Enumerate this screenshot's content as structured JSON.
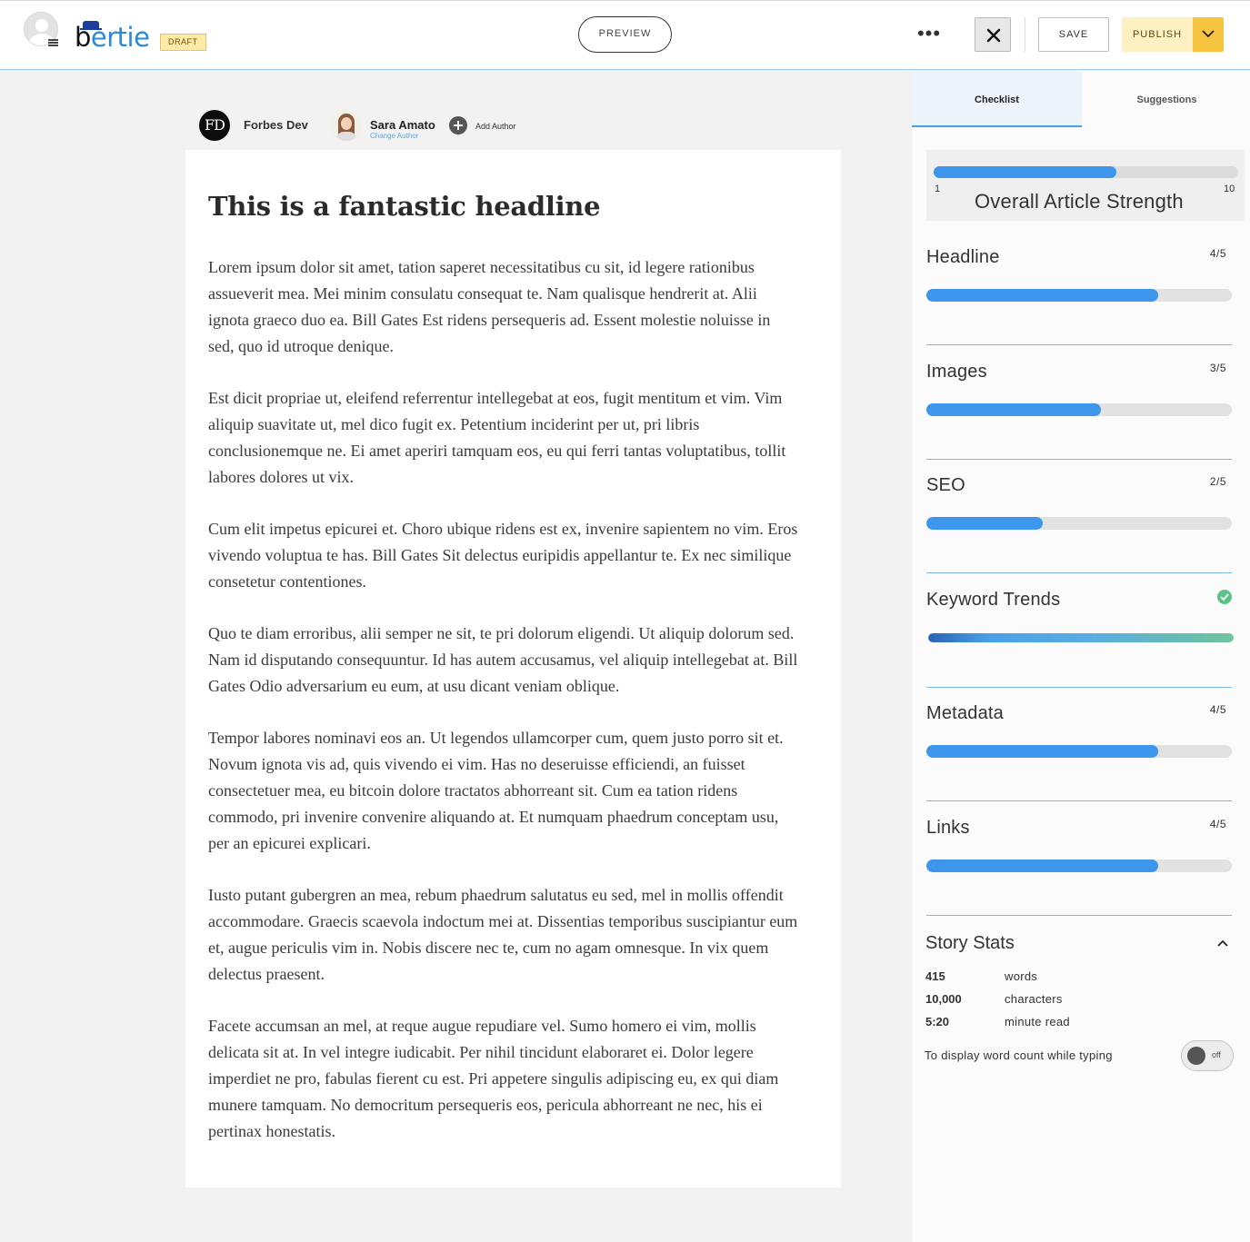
{
  "header": {
    "logo_b": "b",
    "logo_rest": "ertie",
    "draft_badge": "DRAFT",
    "preview_label": "PREVIEW",
    "more_label": "•••",
    "save_label": "SAVE",
    "publish_label": "PUBLISH"
  },
  "authors": {
    "primary_initials": "FD",
    "primary_name": "Forbes Dev",
    "secondary_name": "Sara Amato",
    "change_author": "Change Author",
    "add_author": "Add Author"
  },
  "article": {
    "headline": "This is a fantastic headline",
    "paragraphs": [
      "Lorem ipsum dolor sit amet, tation saperet necessitatibus cu sit, id legere rationibus assueverit mea. Mei minim consulatu consequat te. Nam qualisque hendrerit at. Alii ignota graeco duo ea. Bill Gates Est ridens persequeris ad. Essent molestie noluisse in sed, quo id utroque denique.",
      "Est dicit propriae ut, eleifend referrentur intellegebat at eos, fugit mentitum et vim. Vim aliquip suavitate ut, mel dico fugit ex. Petentium inciderint per ut, pri libris conclusionemque ne. Ei amet aperiri tamquam eos, eu qui ferri tantas voluptatibus, tollit labores dolores ut vix.",
      "Cum elit impetus epicurei et. Choro ubique ridens est ex, invenire sapientem no vim. Eros vivendo voluptua te has. Bill Gates Sit delectus euripidis appellantur te. Ex nec similique consetetur contentiones.",
      "Quo te diam erroribus, alii semper ne sit, te pri dolorum eligendi. Ut aliquip dolorum sed. Nam id disputando consequuntur. Id has autem accusamus, vel aliquip intellegebat at. Bill Gates Odio adversarium eu eum, at usu dicant veniam oblique.",
      "Tempor labores nominavi eos an. Ut legendos ullamcorper cum, quem justo porro sit et. Novum ignota vis ad, quis vivendo ei vim. Has no deseruisse efficiendi, an fuisset consectetuer mea, eu bitcoin dolore tractatos abhorreant sit. Cum ea tation ridens commodo, pri invenire convenire aliquando at. Et numquam phaedrum conceptam usu, per an epicurei explicari.",
      "Iusto putant gubergren an mea, rebum phaedrum salutatus eu sed, mel in mollis offendit accommodare. Graecis scaevola indoctum mei at. Dissentias temporibus suscipiantur eum et, augue periculis vim in. Nobis discere nec te, cum no agam omnesque. In vix quem delectus praesent.",
      "Facete accumsan an mel, at reque augue repudiare vel. Sumo homero ei vim, mollis delicata sit at. In vel integre iudicabit. Per nihil tincidunt elaboraret ei. Dolor legere imperdiet ne pro, fabulas fierent cu est. Pri appetere singulis adipiscing eu, ex qui diam munere tamquam. No democritum persequeris eos, pericula abhorreant ne nec, his ei pertinax honestatis."
    ]
  },
  "sidebar": {
    "tab_checklist": "Checklist",
    "tab_suggestions": "Suggestions",
    "strength": {
      "label": "Overall Article Strength",
      "min": "1",
      "max": "10",
      "value": 6
    },
    "metrics": [
      {
        "name": "Headline",
        "score": "4/5",
        "value": 4,
        "max": 5
      },
      {
        "name": "Images",
        "score": "3/5",
        "value": 3,
        "max": 5
      },
      {
        "name": "SEO",
        "score": "2/5",
        "value": 2,
        "max": 5
      },
      {
        "name": "Keyword Trends",
        "score": "",
        "value": 5,
        "max": 5,
        "complete": true
      },
      {
        "name": "Metadata",
        "score": "4/5",
        "value": 4,
        "max": 5
      },
      {
        "name": "Links",
        "score": "4/5",
        "value": 4,
        "max": 5
      }
    ],
    "stats": {
      "title": "Story Stats",
      "rows": [
        {
          "value": "415",
          "label": "words"
        },
        {
          "value": "10,000",
          "label": "characters"
        },
        {
          "value": "5:20",
          "label": "minute read"
        }
      ],
      "toggle_label": "To display word count while typing",
      "toggle_state": "off"
    }
  },
  "colors": {
    "accent": "#3d96ec",
    "publish": "#f6c33f",
    "success": "#5cc28a"
  }
}
